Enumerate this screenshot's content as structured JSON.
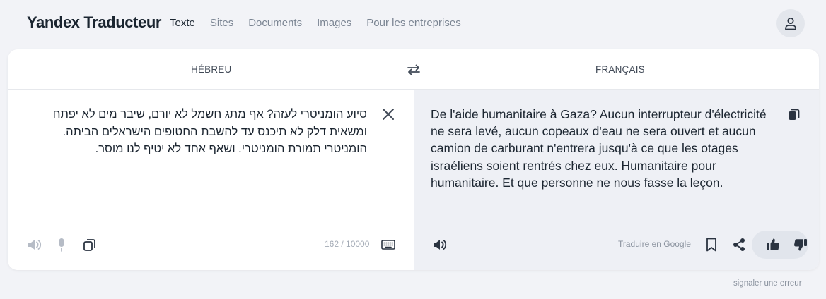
{
  "header": {
    "logo": "Yandex Traducteur",
    "nav": [
      "Texte",
      "Sites",
      "Documents",
      "Images",
      "Pour les entreprises"
    ],
    "active_nav": "Texte"
  },
  "languages": {
    "source": "HÉBREU",
    "target": "FRANÇAIS"
  },
  "source": {
    "text": "סיוע הומניטרי לעזה? אף מתג חשמל לא יורם, שיבר מים לא יפתח ומשאית דלק לא תיכנס עד להשבת החטופים הישראלים הביתה. הומניטרי תמורת הומניטרי. ושאף אחד לא יטיף לנו מוסר.",
    "counter": "162 / 10000"
  },
  "target": {
    "text": "De l'aide humanitaire à Gaza? Aucun interrupteur d'électricité ne sera levé, aucun copeaux d'eau ne sera ouvert et aucun camion de carburant n'entrera jusqu'à ce que les otages israéliens soient rentrés chez eux. Humanitaire pour humanitaire. Et que personne ne nous fasse la leçon.",
    "translate_google": "Traduire en Google"
  },
  "footer": {
    "report": "signaler une erreur"
  },
  "icons": {
    "avatar": "user-icon",
    "swap": "swap-arrows-icon",
    "clear": "close-icon",
    "source_speaker": "speaker-icon",
    "mic": "microphone-icon",
    "source_copy": "copy-icon",
    "keyboard": "keyboard-icon",
    "target_copy": "copy-icon",
    "target_speaker": "speaker-icon",
    "bookmark": "bookmark-icon",
    "share": "share-icon",
    "like": "thumbs-up-icon",
    "dislike": "thumbs-down-icon"
  },
  "colors": {
    "background": "#f2f3f7",
    "card": "#ffffff",
    "target_panel": "#eef0f5",
    "text": "#1b2530",
    "muted": "#7b8593"
  }
}
